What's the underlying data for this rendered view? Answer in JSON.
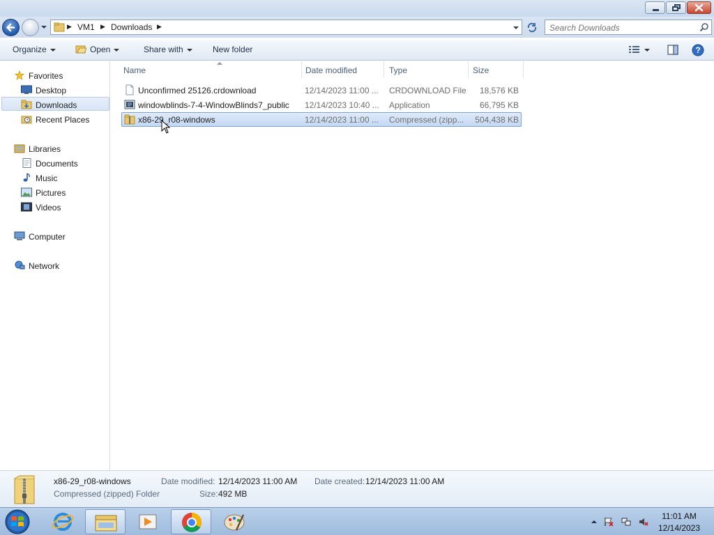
{
  "window": {
    "controls": {
      "minimize": "minimize",
      "maximize": "restore",
      "close": "close"
    }
  },
  "address": {
    "crumbs": [
      "VM1",
      "Downloads"
    ],
    "search_placeholder": "Search Downloads"
  },
  "toolbar": {
    "organize": "Organize",
    "open": "Open",
    "share_with": "Share with",
    "new_folder": "New folder"
  },
  "nav": {
    "favorites": "Favorites",
    "desktop": "Desktop",
    "downloads": "Downloads",
    "recent_places": "Recent Places",
    "libraries": "Libraries",
    "documents": "Documents",
    "music": "Music",
    "pictures": "Pictures",
    "videos": "Videos",
    "computer": "Computer",
    "network": "Network"
  },
  "columns": {
    "name": "Name",
    "date_modified": "Date modified",
    "type": "Type",
    "size": "Size"
  },
  "files": [
    {
      "name": "Unconfirmed 25126.crdownload",
      "date": "12/14/2023 11:00 ...",
      "type": "CRDOWNLOAD File",
      "size": "18,576 KB"
    },
    {
      "name": "windowblinds-7-4-WindowBlinds7_public",
      "date": "12/14/2023 10:40 ...",
      "type": "Application",
      "size": "66,795 KB"
    },
    {
      "name": "x86-29_r08-windows",
      "date": "12/14/2023 11:00 ...",
      "type": "Compressed (zipp...",
      "size": "504,438 KB"
    }
  ],
  "details": {
    "name": "x86-29_r08-windows",
    "kind": "Compressed (zipped) Folder",
    "date_modified_label": "Date modified:",
    "date_modified": "12/14/2023 11:00 AM",
    "date_created_label": "Date created:",
    "date_created": "12/14/2023 11:00 AM",
    "size_label": "Size:",
    "size": "492 MB"
  },
  "taskbar": {
    "time": "11:01 AM",
    "date": "12/14/2023"
  },
  "colors": {
    "selection": "#cde0f7",
    "chrome": "#dce7f3",
    "taskbar": "#a9c3e4"
  }
}
